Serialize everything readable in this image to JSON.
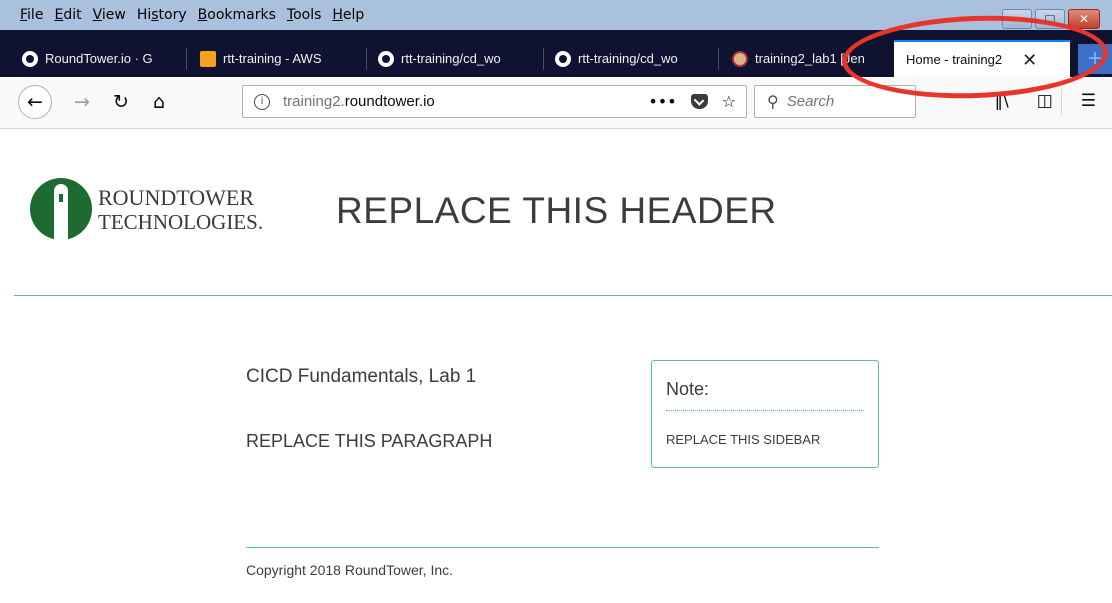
{
  "menubar": {
    "items": [
      {
        "label": "File",
        "access": "F",
        "rest": "ile"
      },
      {
        "label": "Edit",
        "access": "E",
        "rest": "dit"
      },
      {
        "label": "View",
        "access": "V",
        "rest": "iew"
      },
      {
        "label": "History",
        "pre": "Hi",
        "access": "s",
        "rest": "tory"
      },
      {
        "label": "Bookmarks",
        "access": "B",
        "rest": "ookmarks"
      },
      {
        "label": "Tools",
        "access": "T",
        "rest": "ools"
      },
      {
        "label": "Help",
        "access": "H",
        "rest": "elp"
      }
    ]
  },
  "tabs": [
    {
      "label": "RoundTower.io · G",
      "icon": "github-icon"
    },
    {
      "label": "rtt-training - AWS",
      "icon": "aws-icon"
    },
    {
      "label": "rtt-training/cd_wo",
      "icon": "github-icon"
    },
    {
      "label": "rtt-training/cd_wo",
      "icon": "github-icon"
    },
    {
      "label": "training2_lab1 [Jen",
      "icon": "jenkins-icon"
    },
    {
      "label": "Home - training2",
      "icon": "",
      "active": true
    }
  ],
  "navbar": {
    "url_prefix": "training2.",
    "url_domain": "roundtower.io",
    "search_placeholder": "Search"
  },
  "page": {
    "logo_line1": "ROUNDTOWER",
    "logo_line2": "TECHNOLOGIES.",
    "header_title": "REPLACE THIS HEADER",
    "lab_title": "CICD Fundamentals, Lab 1",
    "paragraph": "REPLACE THIS PARAGRAPH",
    "sidebar_title": "Note:",
    "sidebar_text": "REPLACE THIS SIDEBAR",
    "footer": "Copyright 2018 RoundTower, Inc."
  },
  "colors": {
    "accent": "#5bbdb4",
    "annotation": "#e8352a",
    "tabstrip": "#0f1230"
  }
}
